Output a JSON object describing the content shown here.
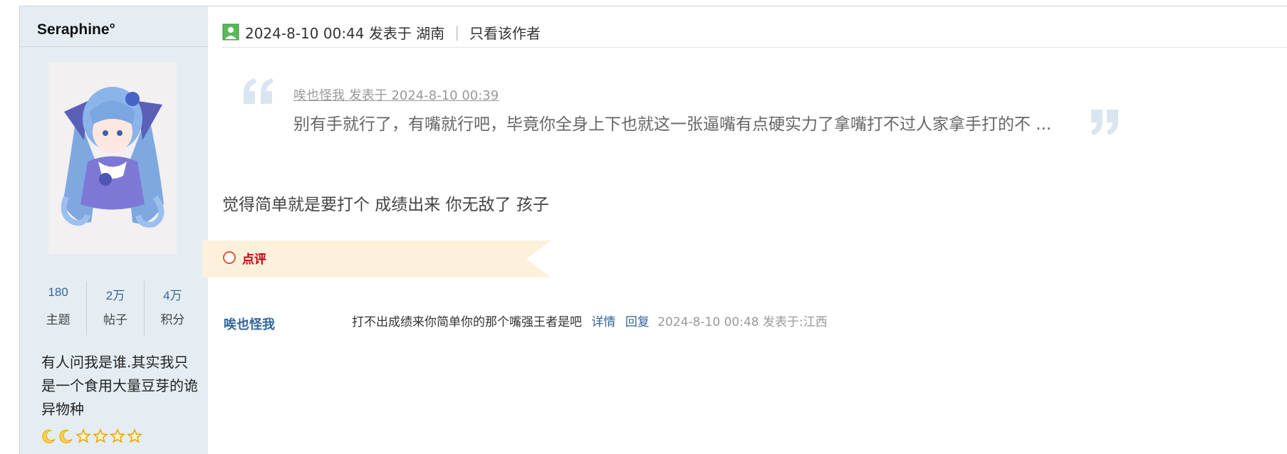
{
  "author": {
    "name": "Seraphine°",
    "stats": [
      {
        "value": "180",
        "label": "主题"
      },
      {
        "value": "2万",
        "label": "帖子"
      },
      {
        "value": "4万",
        "label": "积分"
      }
    ],
    "signature": "有人问我是谁.其实我只是一个食用大量豆芽的诡异物种",
    "level_icons": [
      "moon-icon",
      "moon-icon",
      "star-icon",
      "star-icon",
      "star-icon",
      "star-icon"
    ]
  },
  "post": {
    "timestamp": "2024-8-10 00:44 发表于 湖南",
    "separator": "|",
    "only_author_label": "只看该作者",
    "quote": {
      "meta": "唉也怪我 发表于 2024-8-10 00:39",
      "text": "别有手就行了，有嘴就行吧，毕竟你全身上下也就这一张逼嘴有点硬实力了拿嘴打不过人家拿手打的不 ..."
    },
    "body": "觉得简单就是要打个 成绩出来 你无敌了 孩子",
    "comment_section_label": "点评"
  },
  "comment": {
    "user": "唉也怪我",
    "text": "打不出成绩来你简单你的那个嘴强王者是吧",
    "detail_link": "详情",
    "reply_link": "回复",
    "meta": "2024-8-10 00:48 发表于:江西"
  },
  "colors": {
    "sidebar_bg": "#e5edf2",
    "link": "#336699",
    "comment_label": "#c2000e",
    "comment_tag_bg": "#fdf1dc"
  }
}
